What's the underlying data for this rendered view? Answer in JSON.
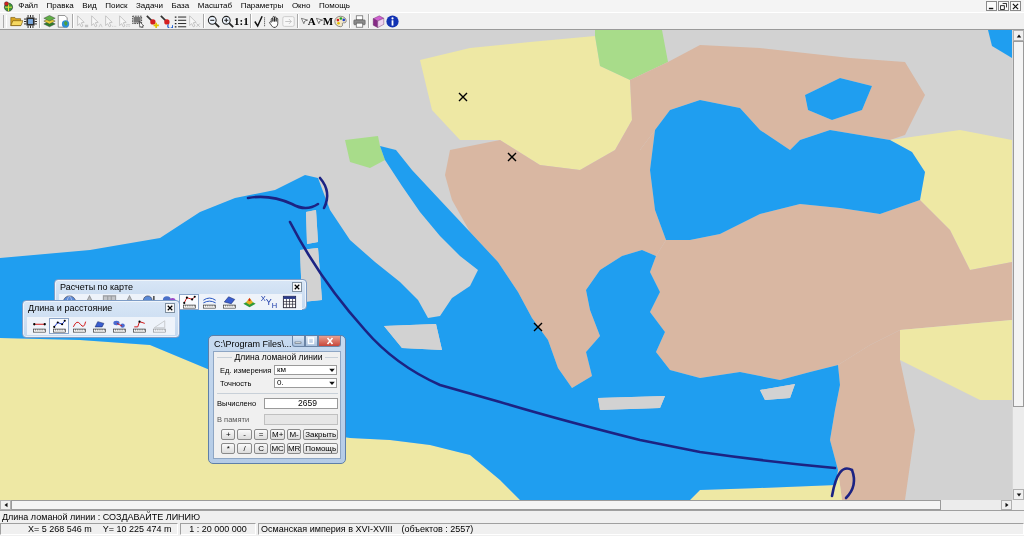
{
  "menu": [
    "Файл",
    "Правка",
    "Вид",
    "Поиск",
    "Задачи",
    "База",
    "Масштаб",
    "Параметры",
    "Окно",
    "Помощь"
  ],
  "toolbar": {
    "groups": [
      [
        {
          "disabled": false
        },
        {
          "disabled": false
        }
      ],
      [
        {
          "disabled": false
        },
        {
          "disabled": false
        }
      ],
      [
        {
          "disabled": true
        },
        {
          "disabled": true
        },
        {
          "disabled": true
        },
        {
          "disabled": true
        },
        {
          "disabled": false
        },
        {
          "disabled": false
        },
        {
          "disabled": false
        },
        {
          "disabled": false
        },
        {
          "disabled": true
        }
      ],
      [
        {
          "disabled": false
        },
        {
          "disabled": false
        },
        {
          "label": "1:1",
          "disabled": false
        }
      ],
      [
        {
          "disabled": false
        },
        {
          "disabled": false
        },
        {
          "disabled": true
        }
      ],
      [
        {
          "label": "A",
          "disabled": false
        },
        {
          "label": "M",
          "disabled": false
        },
        {
          "disabled": false
        }
      ],
      [
        {
          "disabled": false
        }
      ],
      [
        {
          "disabled": false
        },
        {
          "disabled": false
        }
      ]
    ]
  },
  "calc_toolbars": [
    {
      "title": "Расчеты по карте",
      "buttons": [
        {
          "selected": false,
          "disabled": false
        },
        {
          "selected": false,
          "disabled": true
        },
        {
          "selected": false,
          "disabled": true
        },
        {
          "selected": false,
          "disabled": true
        },
        {
          "selected": false,
          "disabled": false
        },
        {
          "selected": false,
          "disabled": false
        },
        {
          "selected": true,
          "disabled": false
        },
        {
          "selected": false,
          "disabled": false
        },
        {
          "selected": false,
          "disabled": false
        },
        {
          "selected": false,
          "disabled": false
        },
        {
          "label": "$^{X}$Y$_{H}$",
          "selected": false,
          "disabled": false
        },
        {
          "selected": false,
          "disabled": false
        }
      ]
    },
    {
      "title": "Длина и расстояние",
      "buttons": [
        {
          "selected": false,
          "disabled": false
        },
        {
          "selected": true,
          "disabled": false
        },
        {
          "selected": false,
          "disabled": false
        },
        {
          "selected": false,
          "disabled": false
        },
        {
          "selected": false,
          "disabled": false
        },
        {
          "selected": false,
          "disabled": false
        },
        {
          "selected": false,
          "disabled": true
        }
      ]
    }
  ],
  "calculator": {
    "title": "C:\\Program Files\\...",
    "group_title": "Длина ломаной линии",
    "dropdowns": [
      {
        "label": "Ед. измерения",
        "value": "км"
      },
      {
        "label": "Точность",
        "value": "0."
      }
    ],
    "readouts": [
      {
        "label": "Вычислено",
        "value": "2659",
        "disabled": false
      },
      {
        "label": "В памяти",
        "disabled": true
      }
    ],
    "buttons": [
      [
        "+",
        "-",
        "=",
        "M+",
        "M-",
        "Закрыть"
      ],
      [
        "*",
        "/",
        "C",
        "MC",
        "MR",
        "Помощь"
      ]
    ]
  },
  "status_line": "Длина ломаной линии : СОЗДАВАЙТЕ ЛИНИЮ",
  "status_bar": {
    "x": "X= 5 268 546 m",
    "y": "Y= 10 225 474 m",
    "scale": "1 : 20 000 000",
    "layer": "Османская империя в XVI-XVIII",
    "objects": "(объектов : 2557)"
  }
}
